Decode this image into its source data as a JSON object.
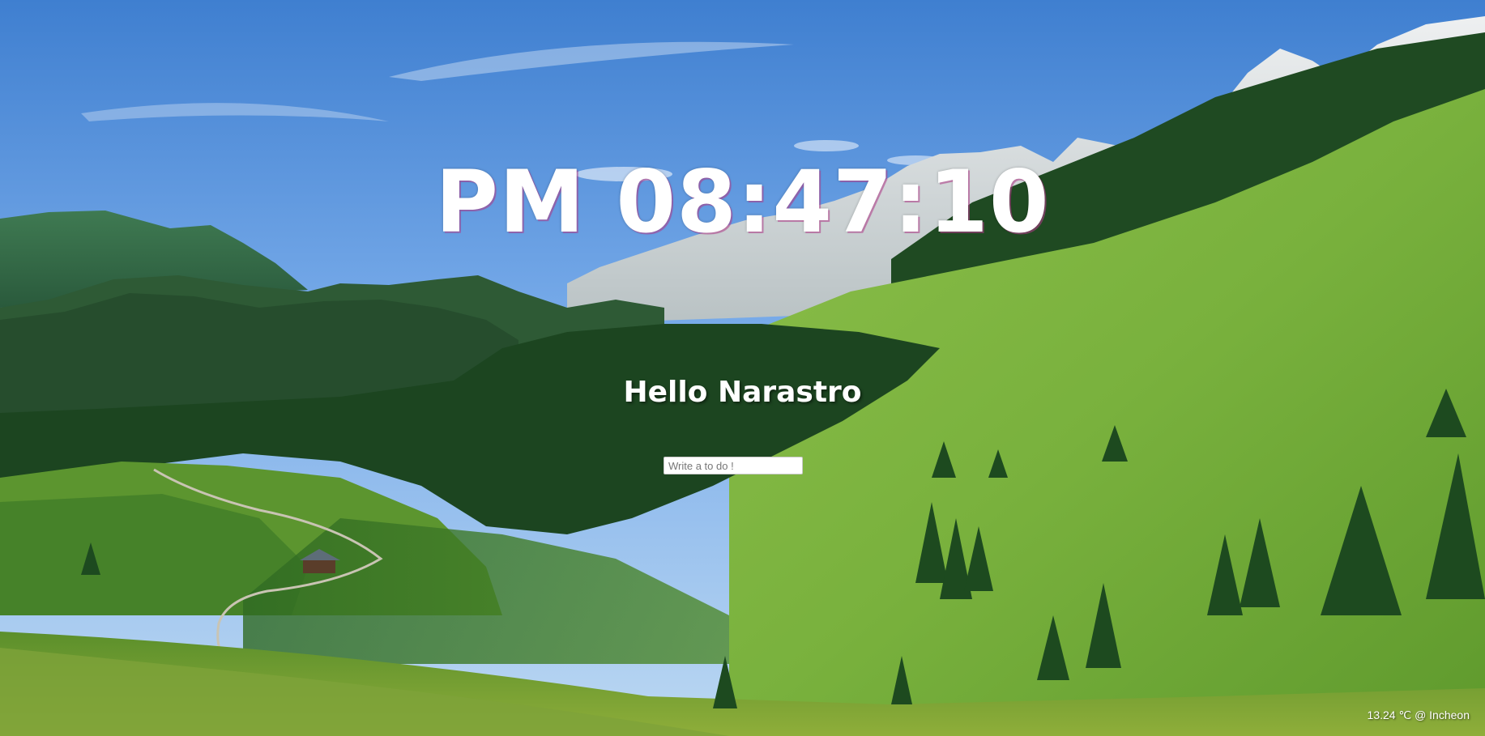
{
  "clock": {
    "period": "PM",
    "time": "08:47:10",
    "display": "PM 08:47:10"
  },
  "greeting": {
    "text": "Hello Narastro"
  },
  "todo": {
    "placeholder": "Write a to do !",
    "value": ""
  },
  "weather": {
    "temperature": "13.24",
    "unit": "℃",
    "location": "Incheon",
    "display": "13.24 ℃ @ Incheon"
  },
  "colors": {
    "sky_top": "#3f7fd0",
    "sky_bottom": "#a9cdef",
    "meadow": "#6fa83a",
    "forest": "#1f4a22",
    "text": "#ffffff"
  },
  "background": {
    "icon": "landscape-photo"
  }
}
